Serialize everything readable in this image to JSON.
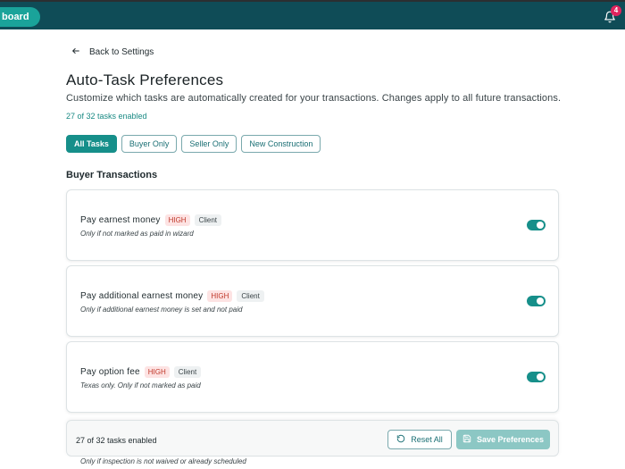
{
  "topbar": {
    "dashboard_label": "board",
    "notification_count": "4"
  },
  "nav": {
    "back_label": "Back to Settings"
  },
  "header": {
    "title": "Auto-Task Preferences",
    "subtitle": "Customize which tasks are automatically created for your transactions. Changes apply to all future transactions.",
    "count": "27 of 32 tasks enabled"
  },
  "filters": [
    {
      "label": "All Tasks",
      "active": true
    },
    {
      "label": "Buyer Only",
      "active": false
    },
    {
      "label": "Seller Only",
      "active": false
    },
    {
      "label": "New Construction",
      "active": false
    }
  ],
  "section": {
    "title": "Buyer Transactions"
  },
  "tasks": [
    {
      "name": "Pay earnest money",
      "priority": "HIGH",
      "assignee": "Client",
      "note": "Only if not marked as paid in wizard",
      "enabled": true
    },
    {
      "name": "Pay additional earnest money",
      "priority": "HIGH",
      "assignee": "Client",
      "note": "Only if additional earnest money is set and not paid",
      "enabled": true
    },
    {
      "name": "Pay option fee",
      "priority": "HIGH",
      "assignee": "Client",
      "note": "Texas only. Only if not marked as paid",
      "enabled": true
    }
  ],
  "peek_note": "Only if inspection is not waived or already scheduled",
  "footer": {
    "count": "27 of 32 tasks enabled",
    "reset_label": "Reset All",
    "save_label": "Save Preferences"
  },
  "colors": {
    "topbar": "#0f4c57",
    "accent": "#168f8a",
    "badge": "#e0245e",
    "high": "#c0392b"
  }
}
